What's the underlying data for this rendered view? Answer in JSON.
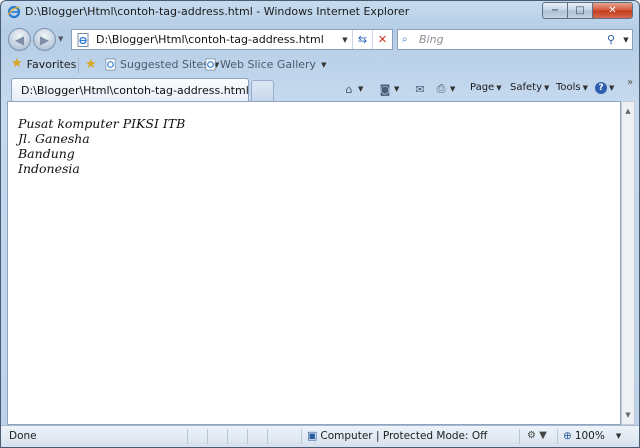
{
  "window": {
    "title": "D:\\Blogger\\Html\\contoh-tag-address.html - Windows Internet Explorer",
    "minimize": "−",
    "maximize": "□",
    "close": "✕"
  },
  "nav": {
    "address": "D:\\Blogger\\Html\\contoh-tag-address.html",
    "search_placeholder": "Bing",
    "back_icon": "back-arrow-icon",
    "forward_icon": "forward-arrow-icon"
  },
  "favorites": {
    "favorites_label": "Favorites",
    "suggested_sites": "Suggested Sites",
    "web_slice_gallery": "Web Slice Gallery"
  },
  "tab": {
    "label": "D:\\Blogger\\Html\\contoh-tag-address.html"
  },
  "commandbar": {
    "page": "Page",
    "safety": "Safety",
    "tools": "Tools"
  },
  "content": {
    "address_lines": [
      "Pusat komputer PIKSI ITB",
      "Jl. Ganesha",
      "Bandung",
      "Indonesia"
    ]
  },
  "status": {
    "done": "Done",
    "zone": "Computer | Protected Mode: Off",
    "zoom": "100%"
  },
  "colors": {
    "frame": "#b4cde6",
    "accent": "#2b66b8",
    "stop": "#c5321c"
  }
}
